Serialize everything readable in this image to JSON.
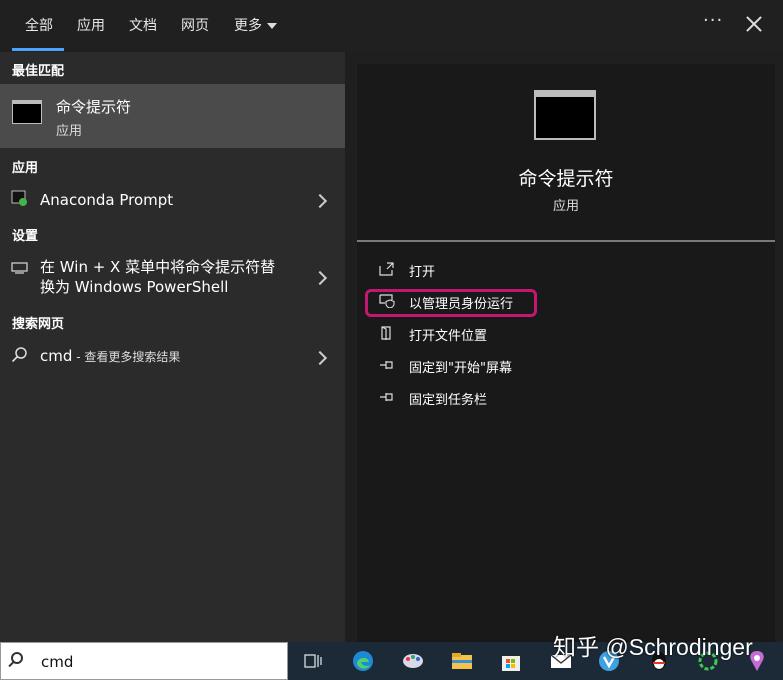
{
  "tabs": [
    {
      "label": "全部",
      "active": true
    },
    {
      "label": "应用"
    },
    {
      "label": "文档"
    },
    {
      "label": "网页"
    },
    {
      "label": "更多"
    }
  ],
  "window_controls": {
    "more": "···"
  },
  "left": {
    "best_match_header": "最佳匹配",
    "best_match": {
      "title": "命令提示符",
      "subtitle": "应用"
    },
    "apps_header": "应用",
    "apps": [
      {
        "label": "Anaconda Prompt"
      }
    ],
    "settings_header": "设置",
    "settings": [
      {
        "line1": "在 Win + X 菜单中将命令提示符替",
        "line2": "换为 Windows PowerShell"
      }
    ],
    "web_header": "搜索网页",
    "web": {
      "query": "cmd",
      "suffix": " - 查看更多搜索结果"
    }
  },
  "right": {
    "title": "命令提示符",
    "subtitle": "应用",
    "actions": [
      {
        "label": "打开",
        "icon": "open-icon"
      },
      {
        "label": "以管理员身份运行",
        "icon": "admin-shield-icon"
      },
      {
        "label": "打开文件位置",
        "icon": "file-location-icon"
      },
      {
        "label": "固定到\"开始\"屏幕",
        "icon": "pin-icon"
      },
      {
        "label": "固定到任务栏",
        "icon": "pin-icon"
      }
    ]
  },
  "taskbar": {
    "search_value": "cmd",
    "icons": [
      "task-view-icon",
      "edge-icon",
      "paint-icon",
      "file-explorer-icon",
      "store-icon",
      "mail-icon",
      "vivaldi-icon",
      "qq-icon",
      "green-ring-icon",
      "maps-icon"
    ]
  },
  "watermark": "知乎 @Schrodinger",
  "colors": {
    "accent": "#4aa3ff",
    "highlight": "#c2186f",
    "selected": "#4b4b4b"
  }
}
